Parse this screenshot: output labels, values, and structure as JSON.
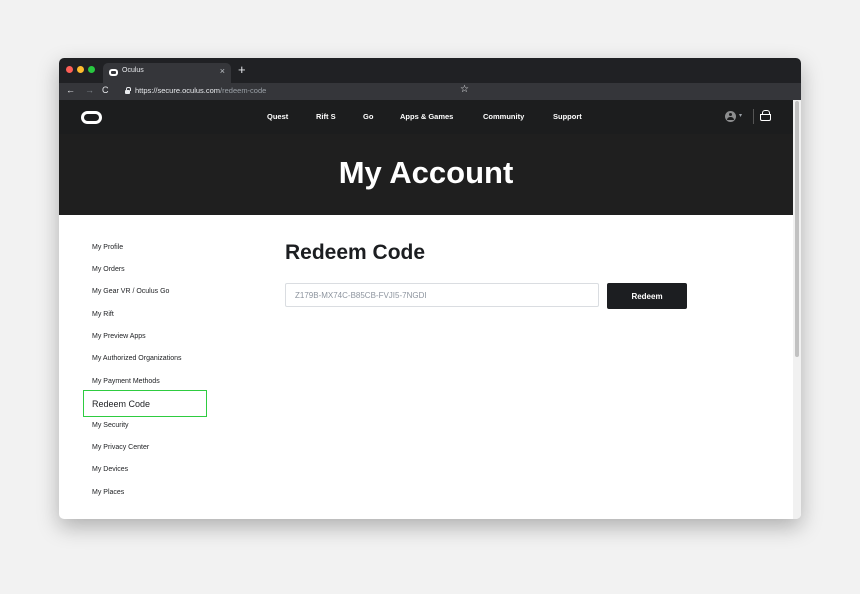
{
  "browser": {
    "tab_title": "Oculus",
    "tab_close": "×",
    "new_tab": "+",
    "back": "←",
    "forward": "→",
    "reload": "C",
    "url_host": "https://secure.oculus.com",
    "url_path": "/redeem-code",
    "bookmark_star": "☆",
    "traffic_light_colors": [
      "#fe5f57",
      "#febc2e",
      "#28c840"
    ]
  },
  "nav": {
    "links": [
      "Quest",
      "Rift S",
      "Go",
      "Apps & Games",
      "Community",
      "Support"
    ],
    "profile_caret": "▾",
    "icons": [
      "oculus-logo-icon",
      "profile-avatar-icon",
      "cart-icon"
    ]
  },
  "hero": {
    "title": "My Account"
  },
  "sidebar": {
    "items": [
      {
        "label": "My Profile"
      },
      {
        "label": "My Orders"
      },
      {
        "label": "My Gear VR / Oculus Go"
      },
      {
        "label": "My Rift"
      },
      {
        "label": "My Preview Apps"
      },
      {
        "label": "My Authorized Organizations"
      },
      {
        "label": "My Payment Methods"
      },
      {
        "label": "Redeem Code",
        "active": true
      },
      {
        "label": "My Security"
      },
      {
        "label": "My Privacy Center"
      },
      {
        "label": "My Devices"
      },
      {
        "label": "My Places"
      }
    ]
  },
  "main": {
    "title": "Redeem Code",
    "code_value": "Z179B-MX74C-B85CB-FVJI5-7NGDI",
    "redeem_label": "Redeem"
  },
  "colors": {
    "header_bg": "#1c1d1e",
    "hero_bg": "#1f1f1f",
    "button_bg": "#1c1e21",
    "active_highlight": "#2ecc40"
  }
}
